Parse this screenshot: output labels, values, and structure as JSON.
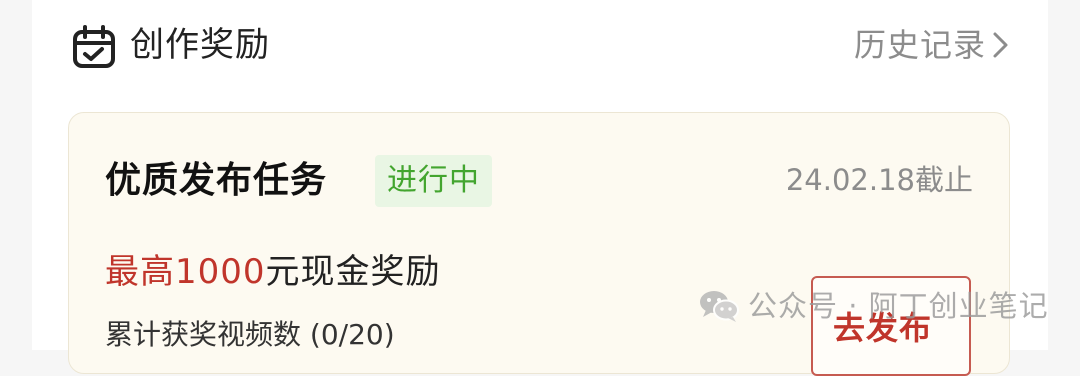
{
  "header": {
    "title": "创作奖励",
    "icon": "calendar-check-icon",
    "history_link": "历史记录",
    "history_icon": "chevron-right-icon"
  },
  "task": {
    "title": "优质发布任务",
    "status": "进行中",
    "deadline": "24.02.18截止",
    "reward_highlight": "最高1000",
    "reward_rest": "元现金奖励",
    "progress": "累计获奖视频数 (0/20)",
    "button_label": "去发布",
    "button_icon": "chevron-right-icon"
  },
  "watermark": {
    "icon": "wechat-icon",
    "text": "公众号 · 阿丁创业笔记"
  },
  "colors": {
    "page_bg": "#f6f6f6",
    "card_bg": "#fdfaf1",
    "accent_red": "#c0352b",
    "status_green": "#43a52f",
    "status_bg": "#e9f6e4",
    "muted_text": "#8c8c8c"
  }
}
